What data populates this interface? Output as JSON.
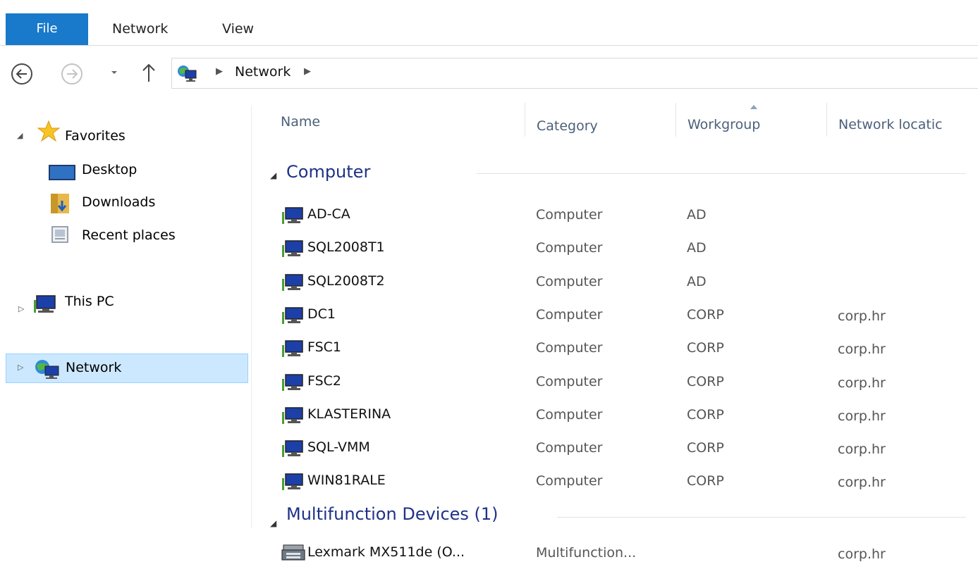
{
  "ribbon": {
    "file": "File",
    "tabs": [
      "Network",
      "View"
    ]
  },
  "address": {
    "crumbs": [
      "Network"
    ]
  },
  "navpane": {
    "favorites": "Favorites",
    "desktop": "Desktop",
    "downloads": "Downloads",
    "recent": "Recent places",
    "this_pc": "This PC",
    "network": "Network"
  },
  "columns": {
    "name": "Name",
    "category": "Category",
    "workgroup": "Workgroup",
    "location": "Network locatic"
  },
  "groups": [
    {
      "title": "Computer",
      "items": [
        {
          "name": "AD-CA",
          "category": "Computer",
          "workgroup": "AD",
          "location": ""
        },
        {
          "name": "SQL2008T1",
          "category": "Computer",
          "workgroup": "AD",
          "location": ""
        },
        {
          "name": "SQL2008T2",
          "category": "Computer",
          "workgroup": "AD",
          "location": ""
        },
        {
          "name": "DC1",
          "category": "Computer",
          "workgroup": "CORP",
          "location": "corp.hr"
        },
        {
          "name": "FSC1",
          "category": "Computer",
          "workgroup": "CORP",
          "location": "corp.hr"
        },
        {
          "name": "FSC2",
          "category": "Computer",
          "workgroup": "CORP",
          "location": "corp.hr"
        },
        {
          "name": "KLASTERINA",
          "category": "Computer",
          "workgroup": "CORP",
          "location": "corp.hr"
        },
        {
          "name": "SQL-VMM",
          "category": "Computer",
          "workgroup": "CORP",
          "location": "corp.hr"
        },
        {
          "name": "WIN81RALE",
          "category": "Computer",
          "workgroup": "CORP",
          "location": "corp.hr"
        }
      ]
    },
    {
      "title": "Multifunction Devices (1)",
      "items": [
        {
          "name": "Lexmark MX511de (O...",
          "category": "Multifunction...",
          "workgroup": "",
          "location": "corp.hr"
        }
      ]
    }
  ],
  "colors": {
    "accent": "#1979ca",
    "group_header": "#1e3287",
    "selection": "#cce8ff"
  },
  "icons": {
    "computer": "computer-icon",
    "printer": "printer-icon",
    "network": "network-icon",
    "star": "star-icon",
    "folder": "downloads-folder-icon"
  }
}
